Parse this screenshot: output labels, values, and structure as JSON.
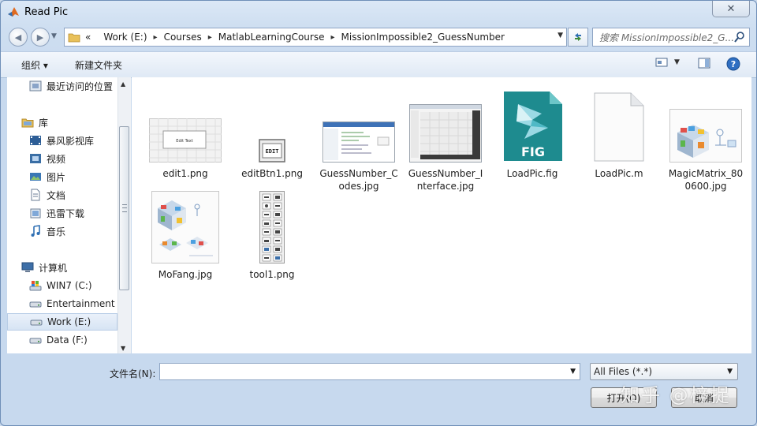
{
  "window": {
    "title": "Read Pic"
  },
  "address": {
    "crumbs": [
      "Work (E:)",
      "Courses",
      "MatlabLearningCourse",
      "MissionImpossible2_GuessNumber"
    ],
    "lead": "«"
  },
  "search": {
    "placeholder": "搜索 MissionImpossible2_G..."
  },
  "toolbar": {
    "organize": "组织 ▾",
    "new_folder": "新建文件夹"
  },
  "sidebar": {
    "items": [
      {
        "label": "最近访问的位置",
        "icon": "recent-places-icon"
      },
      {
        "label": "库",
        "icon": "library-icon"
      },
      {
        "label": "暴风影视库",
        "icon": "video-library-icon"
      },
      {
        "label": "视频",
        "icon": "videos-icon"
      },
      {
        "label": "图片",
        "icon": "pictures-icon"
      },
      {
        "label": "文档",
        "icon": "documents-icon"
      },
      {
        "label": "迅雷下载",
        "icon": "download-folder-icon"
      },
      {
        "label": "音乐",
        "icon": "music-icon"
      },
      {
        "label": "计算机",
        "icon": "computer-icon"
      },
      {
        "label": "WIN7 (C:)",
        "icon": "system-drive-icon"
      },
      {
        "label": "Entertainment (",
        "icon": "drive-icon"
      },
      {
        "label": "Work (E:)",
        "icon": "drive-icon"
      },
      {
        "label": "Data (F:)",
        "icon": "drive-icon"
      }
    ],
    "selected": "Work (E:)"
  },
  "files": [
    {
      "name": "edit1.png",
      "icon": "image-thumbnail"
    },
    {
      "name": "editBtn1.png",
      "icon": "image-thumbnail"
    },
    {
      "name": "GuessNumber_Codes.jpg",
      "icon": "image-thumbnail"
    },
    {
      "name": "GuessNumber_Interface.jpg",
      "icon": "image-thumbnail"
    },
    {
      "name": "LoadPic.fig",
      "icon": "fig-file-icon",
      "badge": "FIG"
    },
    {
      "name": "LoadPic.m",
      "icon": "blank-file-icon"
    },
    {
      "name": "MagicMatrix_800600.jpg",
      "icon": "image-thumbnail"
    },
    {
      "name": "MoFang.jpg",
      "icon": "image-thumbnail"
    },
    {
      "name": "tool1.png",
      "icon": "image-thumbnail"
    }
  ],
  "thumb_text": {
    "edit": "Edit Text",
    "edit_btn": "EDIT"
  },
  "bottom": {
    "filename_label": "文件名(N):",
    "filename_value": "",
    "filter": "All Files (*.*)",
    "open_button": "打开(O)",
    "cancel_button": "取消"
  },
  "watermark": "知乎 @梓捉",
  "colors": {
    "accent": "#3b6ea8",
    "window_frame": "#c7d9ee",
    "fig_teal": "#1e8b8f"
  }
}
